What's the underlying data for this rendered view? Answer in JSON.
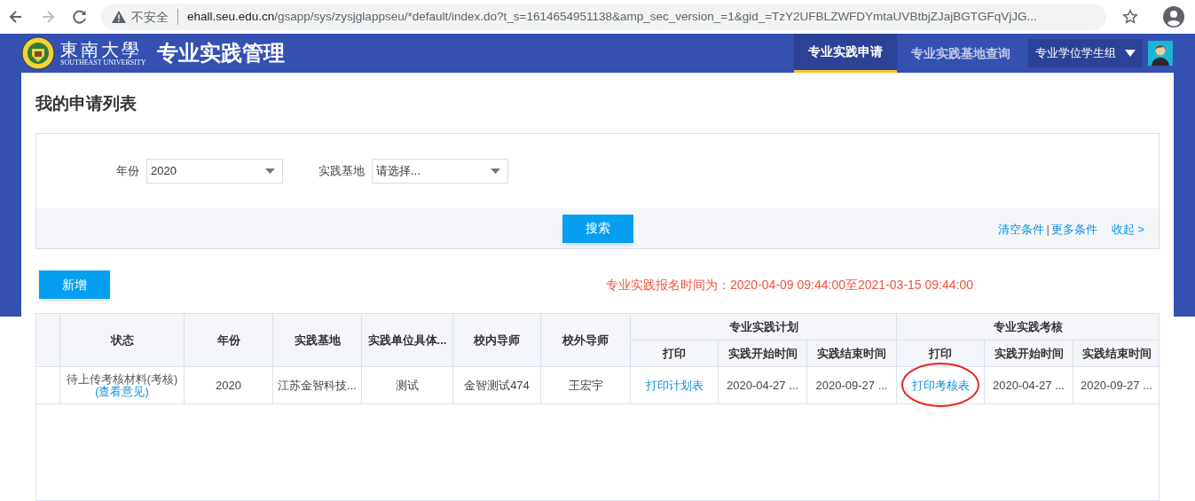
{
  "browser": {
    "security_label": "不安全",
    "url": "ehall.seu.edu.cn/gsapp/sys/zysjglappseu/*default/index.do?t_s=1614654951138&amp_sec_version_=1&gid_=TzY2UFBLZWFDYmtaUVBtbjZJajBGTGFqVjJG..."
  },
  "header": {
    "logo_text": "東南大學",
    "logo_subtext": "SOUTHEAST UNIVERSITY",
    "app_title": "专业实践管理",
    "tabs": [
      {
        "label": "专业实践申请",
        "selected": true
      },
      {
        "label": "专业实践基地查询",
        "selected": false
      }
    ],
    "role": "专业学位学生组"
  },
  "page_title": "我的申请列表",
  "filters": [
    {
      "label": "年份",
      "value": "2020"
    },
    {
      "label": "实践基地",
      "placeholder": "请选择..."
    }
  ],
  "search_button": "搜索",
  "filter_links": [
    "清空条件",
    "|",
    "更多条件",
    "收起 >"
  ],
  "add_button": "新增",
  "notice": "专业实践报名时间为：2020-04-09 09:44:00至2021-03-15 09:44:00",
  "table": {
    "columns": [
      "状态",
      "年份",
      "实践基地",
      "实践单位具体...",
      "校内导师",
      "校外导师"
    ],
    "groups": [
      {
        "title": "专业实践计划",
        "columns": [
          "打印",
          "实践开始时间",
          "实践结束时间"
        ]
      },
      {
        "title": "专业实践考核",
        "columns": [
          "打印",
          "实践开始时间",
          "实践结束时间"
        ]
      }
    ],
    "rows": [
      {
        "cells": [
          {
            "kind": "status",
            "text": "待上传考核材料(考核)",
            "link": "(查看意见)",
            "circled": false
          },
          {
            "kind": "text",
            "text": "2020",
            "circled": false
          },
          {
            "kind": "text",
            "text": "江苏金智科技...",
            "circled": false
          },
          {
            "kind": "text",
            "text": "测试",
            "circled": false
          },
          {
            "kind": "text",
            "text": "金智测试474",
            "circled": false
          },
          {
            "kind": "text",
            "text": "王宏宇",
            "circled": false
          },
          {
            "kind": "link",
            "text": "打印计划表",
            "circled": false
          },
          {
            "kind": "text",
            "text": "2020-04-27 ...",
            "circled": false
          },
          {
            "kind": "text",
            "text": "2020-09-27 ...",
            "circled": false
          },
          {
            "kind": "link",
            "text": "打印考核表",
            "circled": true
          },
          {
            "kind": "text",
            "text": "2020-04-27 ...",
            "circled": false
          },
          {
            "kind": "text",
            "text": "2020-09-27 ...",
            "circled": false
          }
        ]
      }
    ]
  }
}
